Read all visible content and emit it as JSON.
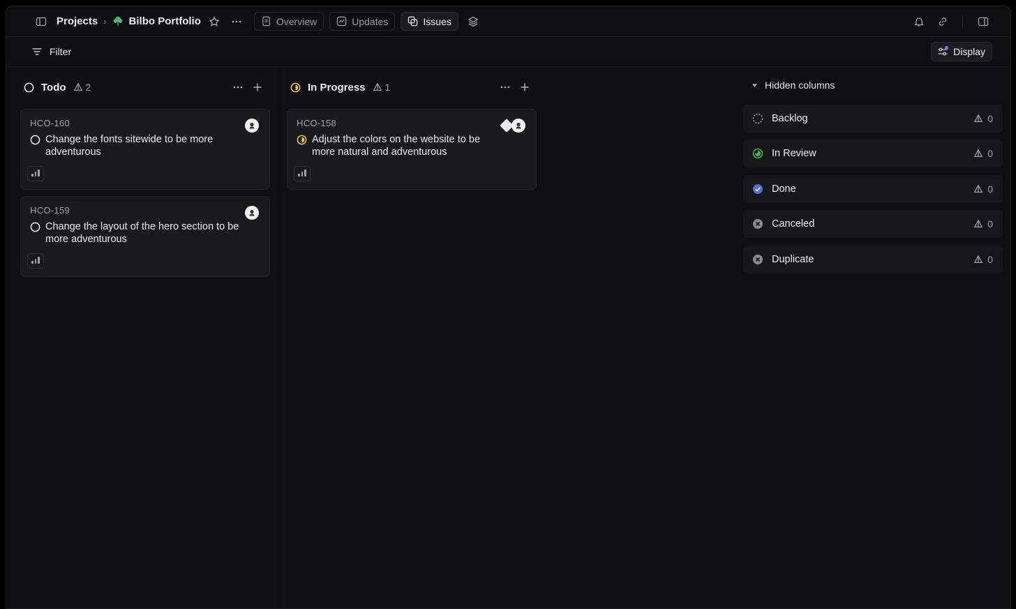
{
  "header": {
    "breadcrumb_root": "Projects",
    "project_name": "Bilbo Portfolio",
    "tabs": [
      {
        "label": "Overview"
      },
      {
        "label": "Updates"
      },
      {
        "label": "Issues"
      }
    ]
  },
  "toolbar": {
    "filter_label": "Filter",
    "display_label": "Display"
  },
  "columns": [
    {
      "name": "Todo",
      "count": "2",
      "cards": [
        {
          "id": "HCO-160",
          "title": "Change the fonts sitewide to be more adventurous"
        },
        {
          "id": "HCO-159",
          "title": "Change the layout of the hero section to be more adventurous"
        }
      ]
    },
    {
      "name": "In Progress",
      "count": "1",
      "cards": [
        {
          "id": "HCO-158",
          "title": "Adjust the colors on the website to be more natural and adventurous"
        }
      ]
    }
  ],
  "hidden_columns": {
    "title": "Hidden columns",
    "items": [
      {
        "label": "Backlog",
        "count": "0",
        "icon": "backlog-dashed-circle-icon"
      },
      {
        "label": "In Review",
        "count": "0",
        "icon": "in-review-green-icon"
      },
      {
        "label": "Done",
        "count": "0",
        "icon": "done-check-icon"
      },
      {
        "label": "Canceled",
        "count": "0",
        "icon": "canceled-x-icon"
      },
      {
        "label": "Duplicate",
        "count": "0",
        "icon": "duplicate-x-icon"
      }
    ]
  },
  "colors": {
    "accent": "#6e7bf2",
    "in_progress": "#f2c94c",
    "in_review": "#3fb950",
    "done": "#5e6ad2"
  }
}
